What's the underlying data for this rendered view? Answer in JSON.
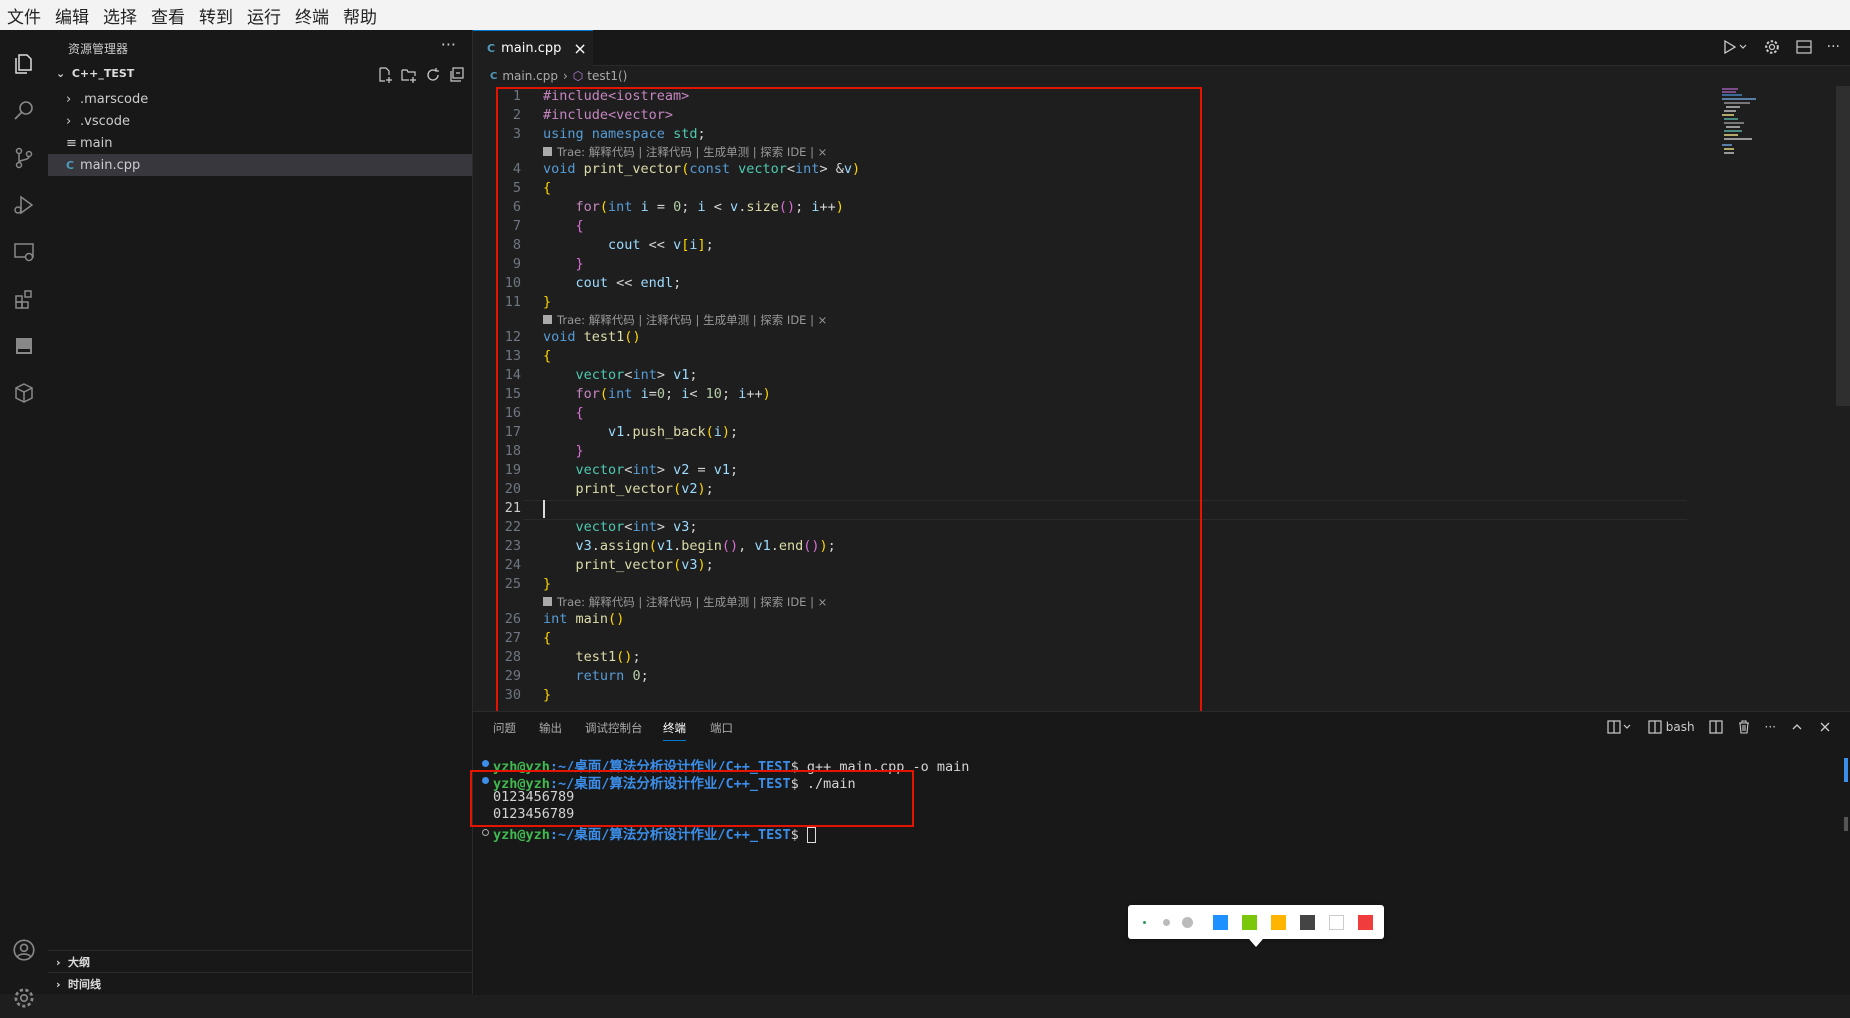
{
  "menu": [
    "文件",
    "编辑",
    "选择",
    "查看",
    "转到",
    "运行",
    "终端",
    "帮助"
  ],
  "explorer": {
    "title": "资源管理器",
    "more": "···",
    "project": "C++_TEST",
    "items": [
      ".marscode",
      ".vscode",
      "main",
      "main.cpp"
    ],
    "outline": "大纲",
    "timeline": "时间线"
  },
  "tab": {
    "label": "main.cpp",
    "close": "×"
  },
  "breadcrumb": {
    "file": "main.cpp",
    "symbol": "test1()"
  },
  "codelens": "Trae: 解释代码 | 注释代码 | 生成单测 | 探索 IDE | ×",
  "line_numbers": [
    "1",
    "2",
    "3",
    "4",
    "5",
    "6",
    "7",
    "8",
    "9",
    "10",
    "11",
    "12",
    "13",
    "14",
    "15",
    "16",
    "17",
    "18",
    "19",
    "20",
    "21",
    "22",
    "23",
    "24",
    "25",
    "26",
    "27",
    "28",
    "29",
    "30"
  ],
  "code_lines": [
    "#include<iostream>",
    "#include<vector>",
    "using namespace std;",
    "void print_vector(const vector<int> &v)",
    "{",
    "    for(int i = 0; i < v.size(); i++)",
    "    {",
    "        cout << v[i];",
    "    }",
    "    cout << endl;",
    "}",
    "void test1()",
    "{",
    "    vector<int> v1;",
    "    for(int i=0; i< 10; i++)",
    "    {",
    "        v1.push_back(i);",
    "    }",
    "    vector<int> v2 = v1;",
    "    print_vector(v2);",
    "",
    "    vector<int> v3;",
    "    v3.assign(v1.begin(), v1.end());",
    "    print_vector(v3);",
    "}",
    "int main()",
    "{",
    "    test1();",
    "    return 0;",
    "}"
  ],
  "panel": {
    "tabs": [
      "问题",
      "输出",
      "调试控制台",
      "终端",
      "端口"
    ],
    "shell": "bash"
  },
  "terminal": {
    "user": "yzh@yzh",
    "path": ":~/桌面/算法分析设计作业/C++_TEST",
    "cmd1": "$ g++ main.cpp -o main",
    "cmd2": "$ ./main",
    "out1": "0123456789",
    "out2": "0123456789",
    "prompt": "$ "
  },
  "colors": {
    "accent": "#0078d4",
    "highlight": "#e51400",
    "swatches": [
      "#1e90ff",
      "#7ac70c",
      "#ffb400",
      "#444444",
      "#ffffff",
      "#f03c3c"
    ]
  }
}
